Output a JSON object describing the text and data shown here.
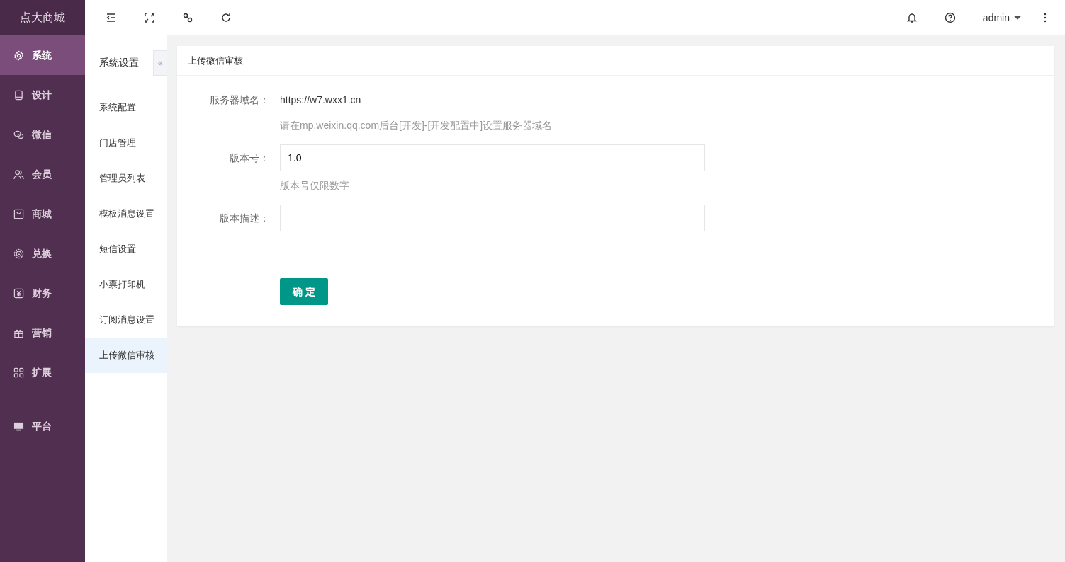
{
  "brand": "点大商城",
  "sidebar": {
    "items": [
      {
        "label": "系统",
        "selected": true
      },
      {
        "label": "设计",
        "selected": false
      },
      {
        "label": "微信",
        "selected": false
      },
      {
        "label": "会员",
        "selected": false
      },
      {
        "label": "商城",
        "selected": false
      },
      {
        "label": "兑换",
        "selected": false
      },
      {
        "label": "财务",
        "selected": false
      },
      {
        "label": "营销",
        "selected": false
      },
      {
        "label": "扩展",
        "selected": false
      }
    ],
    "bottom_items": [
      {
        "label": "平台",
        "selected": false
      }
    ]
  },
  "toolbar": {
    "user": "admin"
  },
  "subnav": {
    "title": "系统设置",
    "items": [
      {
        "label": "系统配置",
        "selected": false
      },
      {
        "label": "门店管理",
        "selected": false
      },
      {
        "label": "管理员列表",
        "selected": false
      },
      {
        "label": "模板消息设置",
        "selected": false
      },
      {
        "label": "短信设置",
        "selected": false
      },
      {
        "label": "小票打印机",
        "selected": false
      },
      {
        "label": "订阅消息设置",
        "selected": false
      },
      {
        "label": "上传微信审核",
        "selected": true
      }
    ]
  },
  "card": {
    "title": "上传微信审核",
    "fields": [
      {
        "kind": "text",
        "label": "服务器域名：",
        "value": "https://w7.wxx1.cn",
        "hint": "请在mp.weixin.qq.com后台[开发]-[开发配置中]设置服务器域名"
      },
      {
        "kind": "input",
        "label": "版本号：",
        "value": "1.0",
        "hint": "版本号仅限数字"
      },
      {
        "kind": "input",
        "label": "版本描述："
      }
    ],
    "submit": "确 定"
  }
}
